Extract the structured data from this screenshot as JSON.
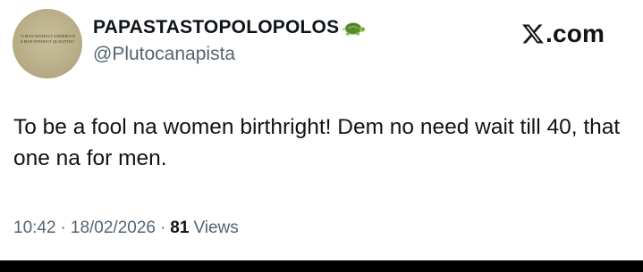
{
  "author": {
    "display_name": "PAPASTASTOPOLOPOLOS",
    "handle": "@Plutocanapista",
    "avatar_icon": "portrait-quote-image",
    "avatar_text": "\"A MAN WITHOUT ENEMIES IS A MAN WITHOUT QUALITIES\"",
    "name_emoji": "turtle-icon"
  },
  "brand": {
    "logo": "x-logo-icon",
    "domain": ".com"
  },
  "tweet": {
    "text": "To be a fool na women birthright! Dem no need wait till 40, that one na for men."
  },
  "meta": {
    "time": "10:42",
    "separator": "·",
    "date": "18/02/2026",
    "views_count": "81",
    "views_label": "Views"
  },
  "colors": {
    "text_primary": "#0f1419",
    "text_secondary": "#536471",
    "background": "#ffffff"
  }
}
